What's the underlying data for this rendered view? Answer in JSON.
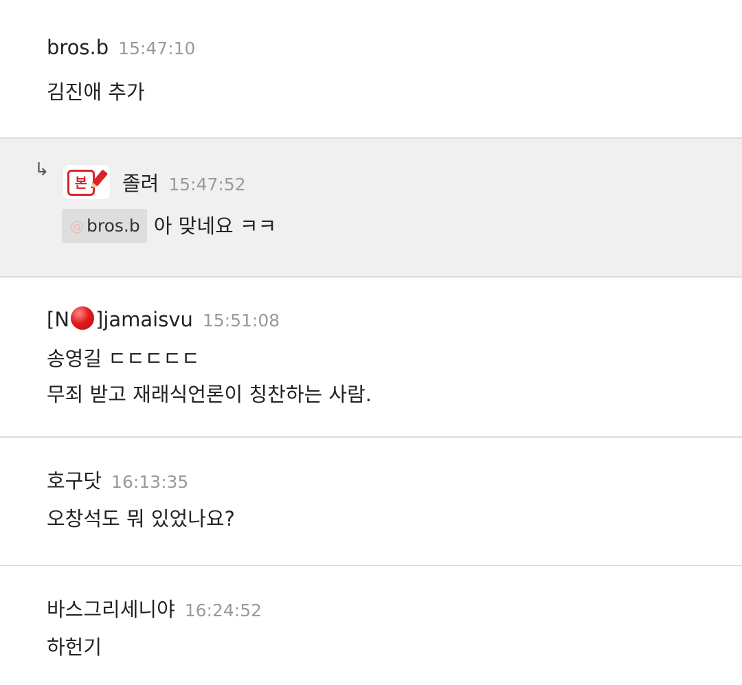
{
  "comments": [
    {
      "nickname": "bros.b",
      "time": "15:47:10",
      "lines": [
        "김진애 추가"
      ]
    },
    {
      "is_reply": true,
      "reply_icon": "reply-arrow-icon",
      "reply_arrow_glyph": "↳",
      "avatar_icon": "badge-pencil-icon",
      "avatar_text": "본",
      "nickname": "졸려",
      "time": "15:47:52",
      "mention_symbol": "@",
      "mention": "bros.b",
      "text": "아 맞네요 ㅋㅋ"
    },
    {
      "nickname_prefix": "[N",
      "nickname_icon": "red-circle-icon",
      "nickname_suffix": "]jamaisvu",
      "time": "15:51:08",
      "lines": [
        "송영길 ㄷㄷㄷㄷㄷ",
        "무죄 받고 재래식언론이 칭찬하는 사람."
      ]
    },
    {
      "nickname": "호구닷",
      "time": "16:13:35",
      "lines": [
        "오창석도 뭐 있었나요?"
      ]
    },
    {
      "nickname": "바스그리세니야",
      "time": "16:24:52",
      "lines": [
        "하헌기"
      ]
    }
  ],
  "colors": {
    "reply_background": "#f0f0f0",
    "divider": "#dcdcdc",
    "time_text": "#9a9a9a",
    "badge_red": "#d8242a"
  }
}
